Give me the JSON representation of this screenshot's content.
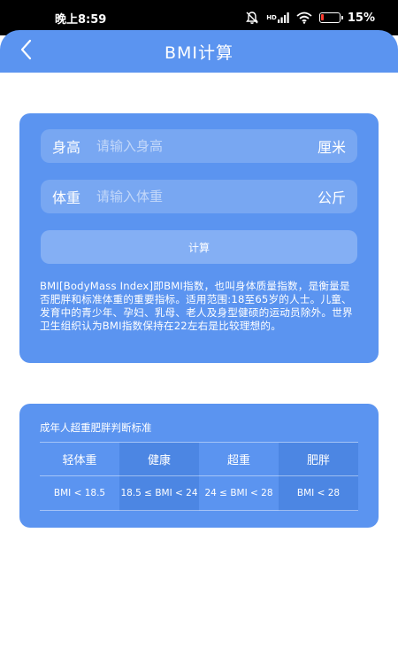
{
  "status_bar": {
    "time": "晚上8:59",
    "network_label": "HD",
    "battery_percent": "15%",
    "battery_level": 0.15,
    "icons": [
      "mute-bell-icon",
      "signal-icon",
      "wifi-icon",
      "battery-icon"
    ]
  },
  "header": {
    "title": "BMI计算",
    "back_icon": "chevron-left-icon"
  },
  "form": {
    "height": {
      "label": "身高",
      "placeholder": "请输入身高",
      "value": "",
      "unit": "厘米"
    },
    "weight": {
      "label": "体重",
      "placeholder": "请输入体重",
      "value": "",
      "unit": "公斤"
    },
    "calculate_label": "计算",
    "description": "BMI[BodyMass Index]即BMI指数，也叫身体质量指数，是衡量是否肥胖和标准体重的重要指标。适用范围:18至65岁的人士。儿童、发育中的青少年、孕妇、乳母、老人及身型健硕的运动员除外。世界卫生组织认为BMI指数保持在22左右是比较理想的。"
  },
  "standards": {
    "title": "成年人超重肥胖判断标准",
    "columns": [
      "轻体重",
      "健康",
      "超重",
      "肥胖"
    ],
    "values": [
      "BMI < 18.5",
      "18.5 ≤ BMI < 24",
      "24 ≤ BMI < 28",
      "BMI < 28"
    ]
  },
  "colors": {
    "accent": "#5b94f0",
    "accent_dark": "#4c86e3",
    "background": "#ffffff",
    "status_bar": "#000000",
    "battery_low": "#ff3b30"
  }
}
